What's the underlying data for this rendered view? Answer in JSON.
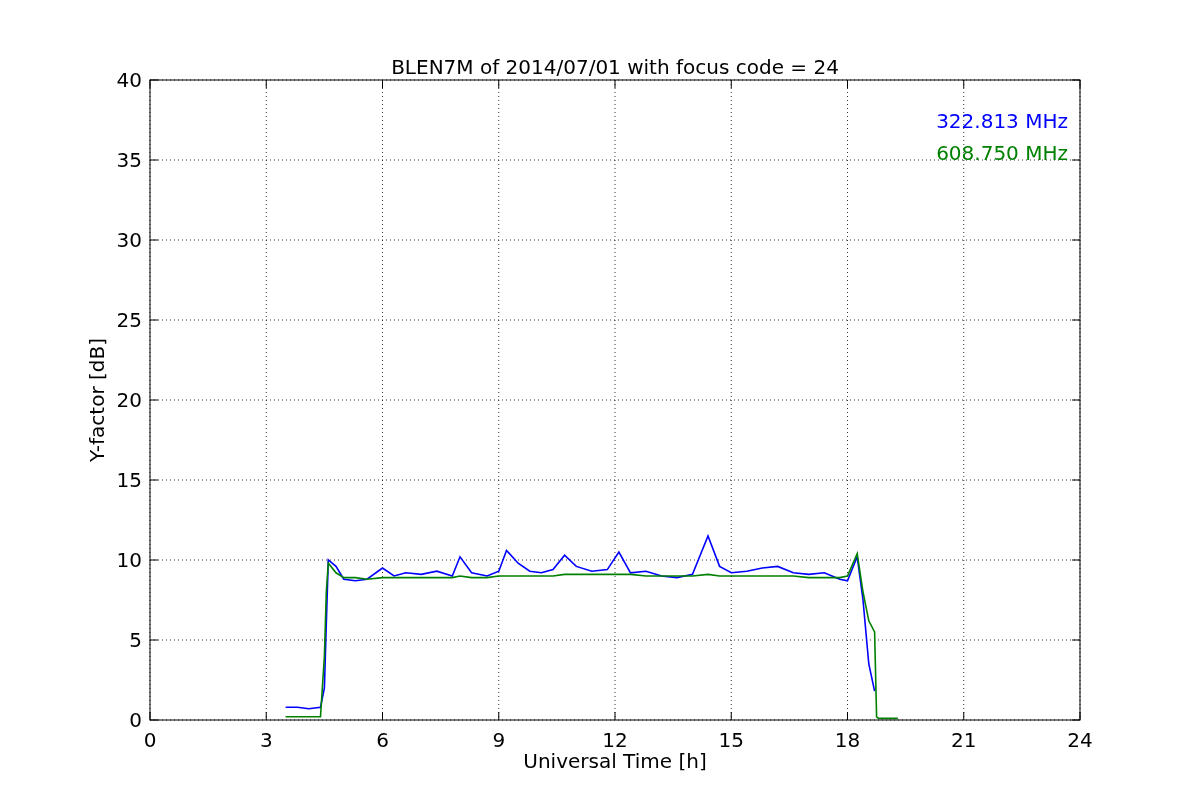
{
  "chart_data": {
    "type": "line",
    "title": "BLEN7M of 2014/07/01 with focus code = 24",
    "xlabel": "Universal Time [h]",
    "ylabel": "Y-factor [dB]",
    "x": [
      3.5,
      3.8,
      4.1,
      4.4,
      4.5,
      4.55,
      4.6,
      4.8,
      5.0,
      5.3,
      5.6,
      6.0,
      6.3,
      6.6,
      7.0,
      7.4,
      7.8,
      8.0,
      8.3,
      8.7,
      9.0,
      9.2,
      9.5,
      9.8,
      10.1,
      10.4,
      10.7,
      11.0,
      11.4,
      11.8,
      12.1,
      12.4,
      12.8,
      13.2,
      13.6,
      14.0,
      14.4,
      14.7,
      15.0,
      15.4,
      15.8,
      16.2,
      16.6,
      17.0,
      17.4,
      17.8,
      18.0,
      18.25,
      18.4,
      18.55,
      18.7,
      18.75,
      18.8,
      19.0,
      19.3
    ],
    "series": [
      {
        "name": "322.813 MHz",
        "color": "#0000ff",
        "values": [
          0.8,
          0.8,
          0.7,
          0.8,
          2.0,
          6,
          10.0,
          9.6,
          8.8,
          8.7,
          8.8,
          9.5,
          9.0,
          9.2,
          9.1,
          9.3,
          9.0,
          10.2,
          9.2,
          9.0,
          9.3,
          10.6,
          9.8,
          9.3,
          9.2,
          9.4,
          10.3,
          9.6,
          9.3,
          9.4,
          10.5,
          9.2,
          9.3,
          9.0,
          8.9,
          9.1,
          11.5,
          9.6,
          9.2,
          9.3,
          9.5,
          9.6,
          9.2,
          9.1,
          9.2,
          8.8,
          8.7,
          10.2,
          7.5,
          3.5,
          1.8,
          null,
          null,
          null,
          null
        ]
      },
      {
        "name": "608.750 MHz",
        "color": "#008000",
        "values": [
          0.2,
          0.2,
          0.2,
          0.2,
          4.0,
          8,
          9.8,
          9.2,
          8.9,
          8.9,
          8.8,
          8.9,
          8.9,
          8.9,
          8.9,
          8.9,
          8.9,
          9.0,
          8.9,
          8.9,
          9.0,
          9.0,
          9.0,
          9.0,
          9.0,
          9.0,
          9.1,
          9.1,
          9.1,
          9.1,
          9.1,
          9.1,
          9.0,
          9.0,
          9.0,
          9.0,
          9.1,
          9.0,
          9.0,
          9.0,
          9.0,
          9.0,
          9.0,
          8.9,
          8.9,
          8.9,
          9.0,
          10.4,
          8.0,
          6.2,
          5.5,
          0.2,
          0.1,
          0.1,
          0.1
        ]
      }
    ],
    "grid": true,
    "xlim": [
      0,
      24
    ],
    "ylim": [
      0,
      40
    ],
    "xticks": [
      0,
      3,
      6,
      9,
      12,
      15,
      18,
      21,
      24
    ],
    "yticks": [
      0,
      5,
      10,
      15,
      20,
      25,
      30,
      35,
      40
    ]
  }
}
